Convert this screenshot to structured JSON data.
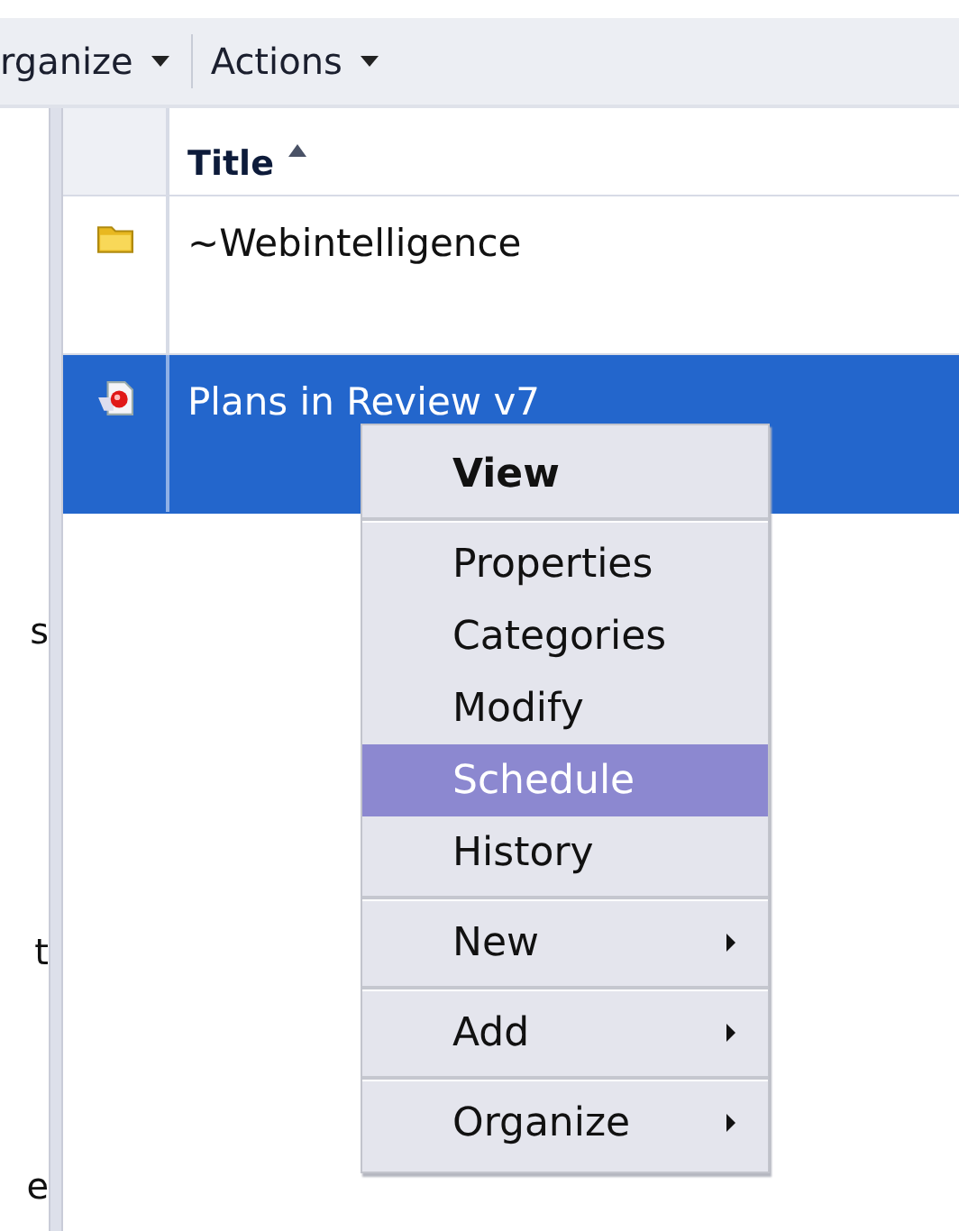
{
  "toolbar": {
    "menus": [
      {
        "label": "rganize",
        "has_dropdown": true
      },
      {
        "label": "Actions",
        "has_dropdown": true
      }
    ]
  },
  "left_panel": {
    "fragments": [
      "s",
      "t",
      "e"
    ]
  },
  "table": {
    "columns": [
      {
        "label": "Title",
        "sorted_ascending": true
      }
    ],
    "rows": [
      {
        "title": "~Webintelligence",
        "kind": "folder",
        "selected": false
      },
      {
        "title": "Plans in Review v7",
        "kind": "document",
        "selected": true
      }
    ]
  },
  "context_menu": {
    "groups": [
      [
        {
          "label": "View",
          "kind": "default",
          "selected": false
        }
      ],
      [
        {
          "label": "Properties",
          "kind": "item",
          "selected": false
        },
        {
          "label": "Categories",
          "kind": "item",
          "selected": false
        },
        {
          "label": "Modify",
          "kind": "item",
          "selected": false
        },
        {
          "label": "Schedule",
          "kind": "item",
          "selected": true
        },
        {
          "label": "History",
          "kind": "item",
          "selected": false
        }
      ],
      [
        {
          "label": "New",
          "kind": "submenu",
          "selected": false
        }
      ],
      [
        {
          "label": "Add",
          "kind": "submenu",
          "selected": false
        }
      ],
      [
        {
          "label": "Organize",
          "kind": "submenu",
          "selected": false
        }
      ]
    ]
  }
}
